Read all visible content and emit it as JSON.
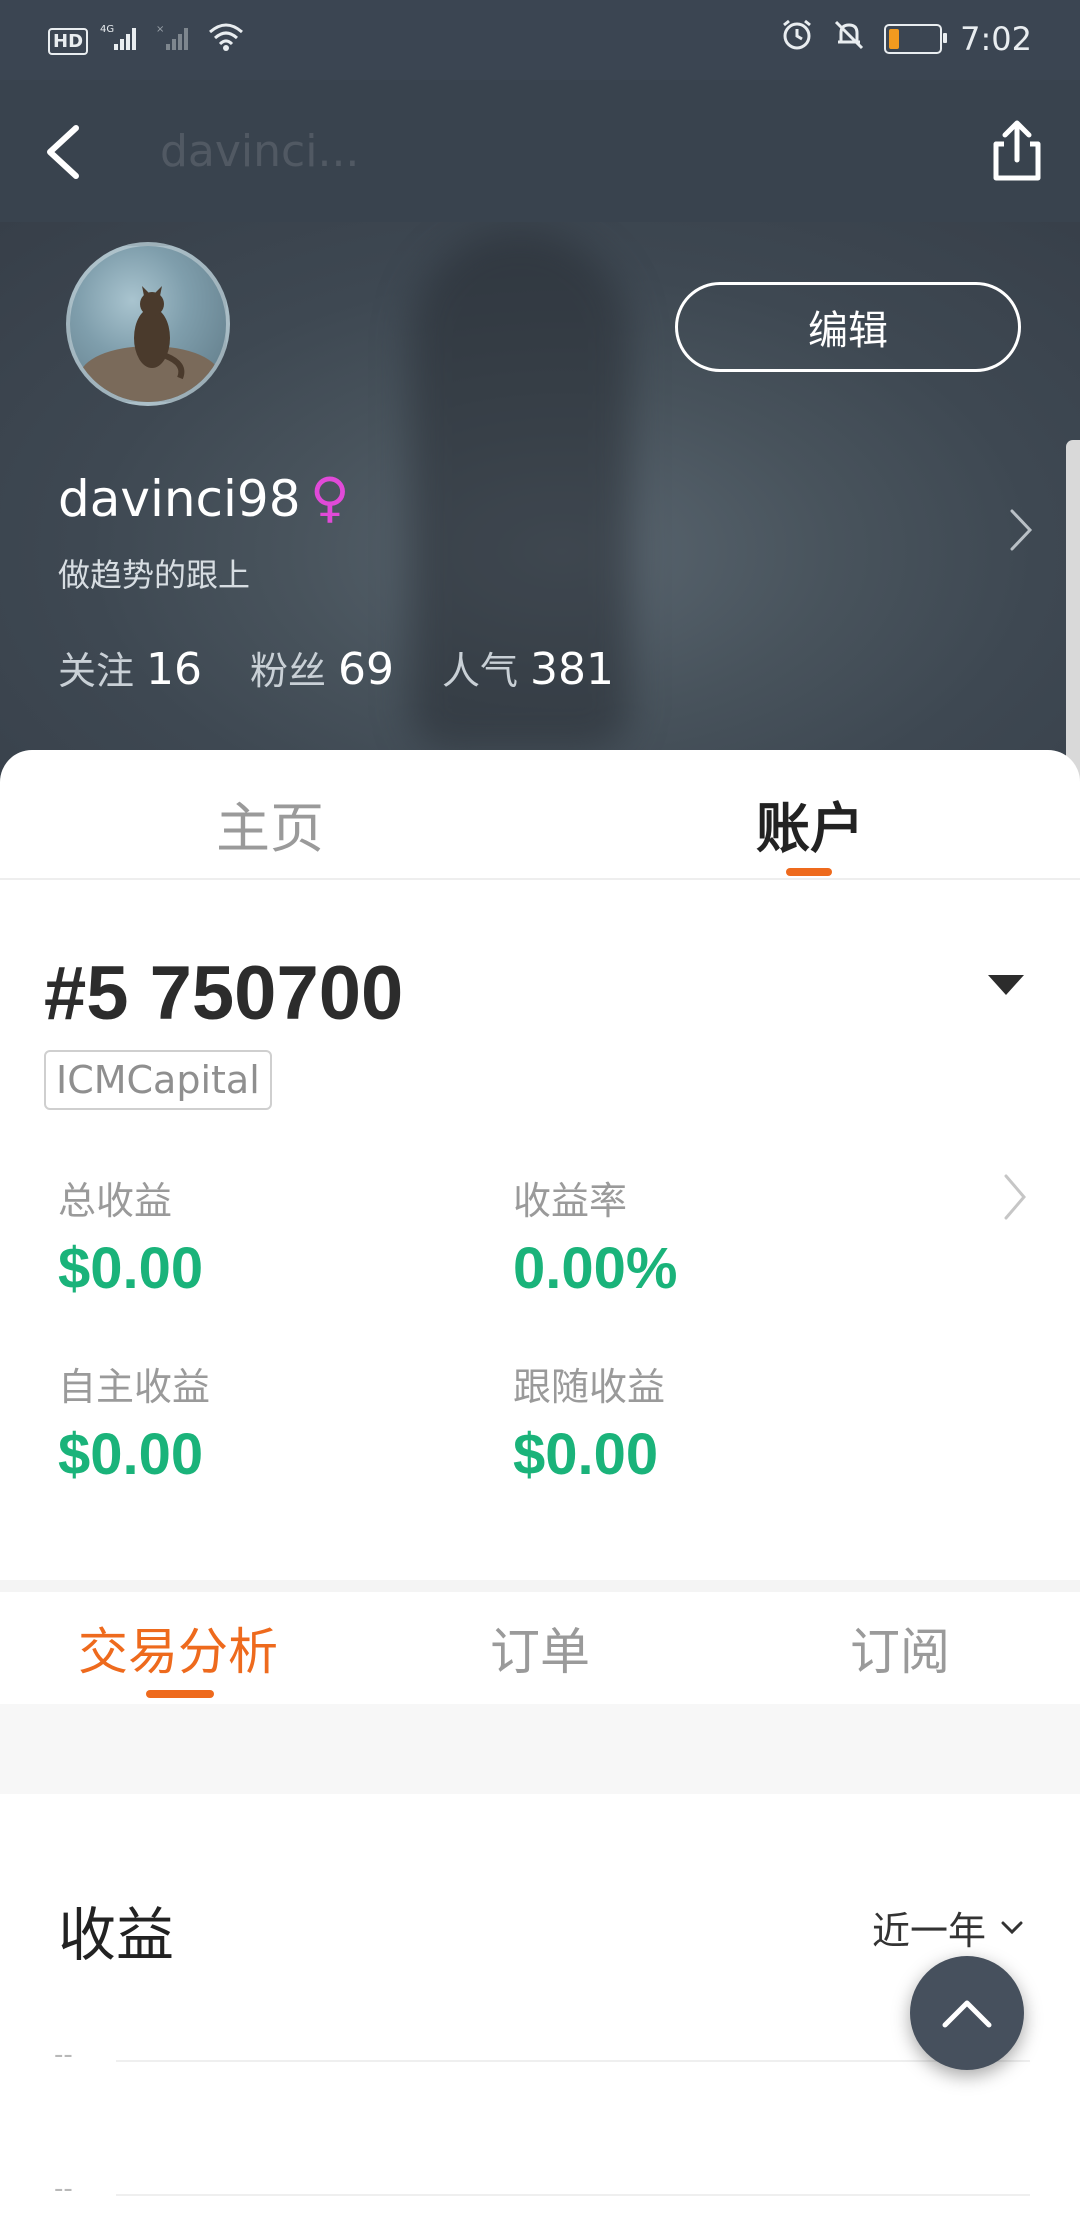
{
  "status_bar": {
    "hd": "HD",
    "network": "4G",
    "time": "7:02"
  },
  "top_bar": {
    "faded_title": "davinci..."
  },
  "profile": {
    "edit_label": "编辑",
    "username": "davinci98",
    "gender_symbol": "♀",
    "bio": "做趋势的跟上",
    "stats": [
      {
        "label": "关注",
        "value": "16"
      },
      {
        "label": "粉丝",
        "value": "69"
      },
      {
        "label": "人气",
        "value": "381"
      }
    ]
  },
  "main_tabs": {
    "home": "主页",
    "account": "账户",
    "selected": "account"
  },
  "account": {
    "number": "#5 750700",
    "broker": "ICMCapital",
    "metrics": [
      {
        "label": "总收益",
        "value": "$0.00"
      },
      {
        "label": "收益率",
        "value": "0.00%"
      },
      {
        "label": "自主收益",
        "value": "$0.00"
      },
      {
        "label": "跟随收益",
        "value": "$0.00"
      }
    ]
  },
  "sub_tabs": {
    "items": [
      "交易分析",
      "订单",
      "订阅"
    ],
    "selected": "交易分析"
  },
  "income": {
    "title": "收益",
    "period": "近一年",
    "ticks": [
      "--",
      "--"
    ]
  },
  "colors": {
    "accent": "#ee6a1d",
    "positive": "#1ab37a",
    "gender": "#e14ad8",
    "header": "#39434e"
  }
}
